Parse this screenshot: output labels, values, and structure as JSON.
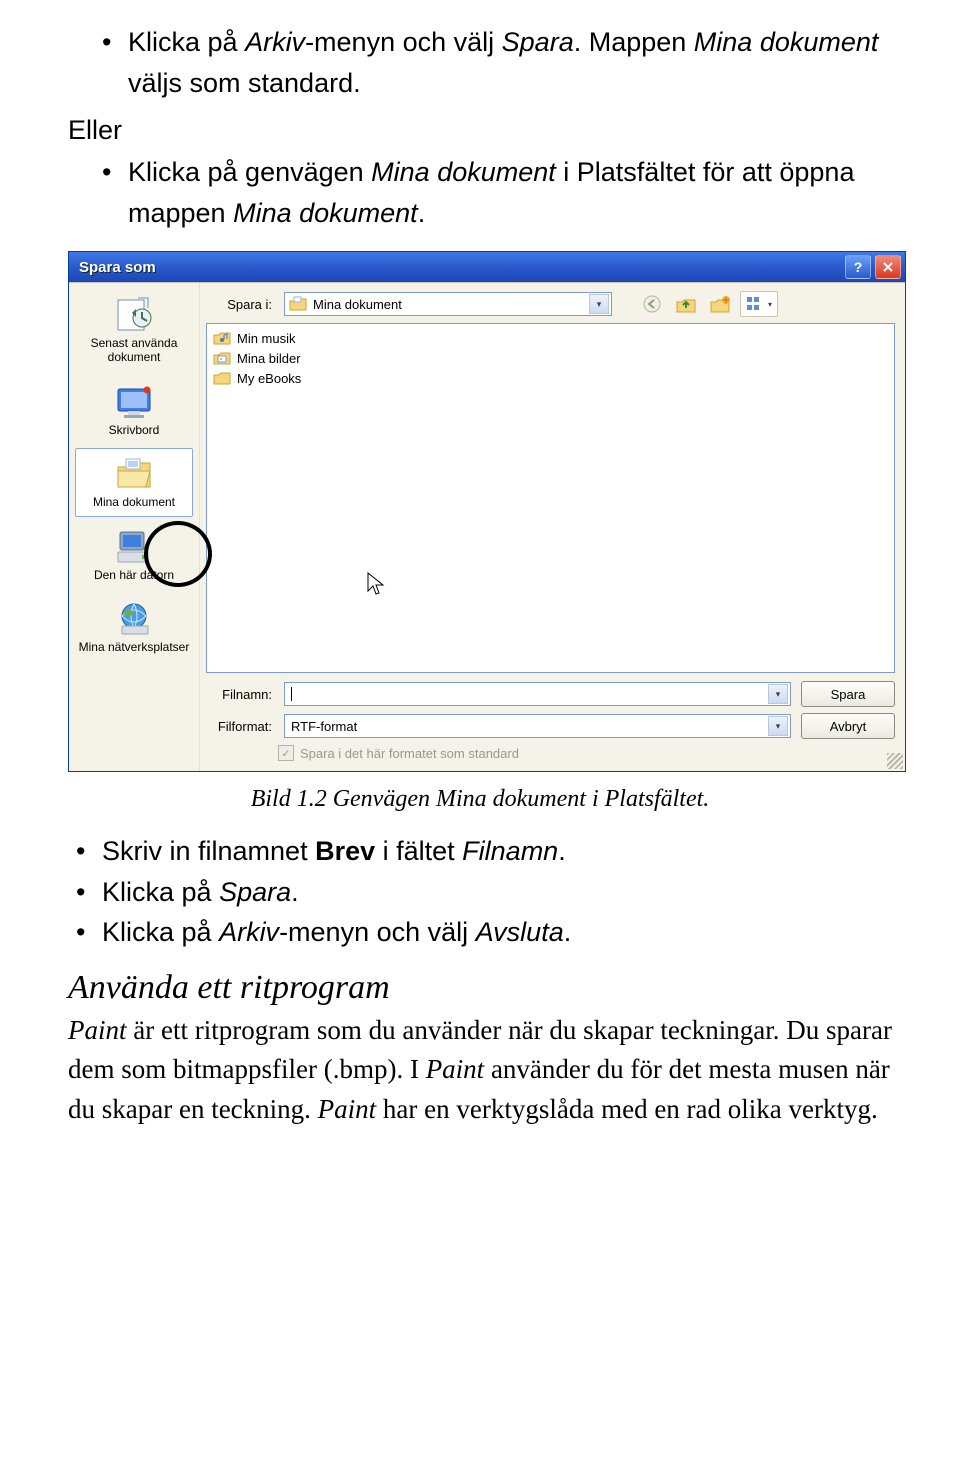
{
  "doc": {
    "bullet1_a": "Klicka på ",
    "bullet1_b": "Arkiv",
    "bullet1_c": "-menyn och välj ",
    "bullet1_d": "Spara",
    "bullet1_e": ". Mappen ",
    "bullet1_f": "Mina dokument",
    "bullet1_g": " väljs som standard.",
    "eller": "Eller",
    "bullet2_a": "Klicka på genvägen ",
    "bullet2_b": "Mina dokument",
    "bullet2_c": " i Platsfältet för att öppna mappen ",
    "bullet2_d": "Mina dokument",
    "bullet2_e": ".",
    "caption": "Bild 1.2 Genvägen Mina dokument i Platsfältet.",
    "bullet3_a": "Skriv in filnamnet ",
    "bullet3_b": "Brev",
    "bullet3_c": " i fältet ",
    "bullet3_d": "Filnamn",
    "bullet3_e": ".",
    "bullet4_a": "Klicka på ",
    "bullet4_b": "Spara",
    "bullet4_c": ".",
    "bullet5_a": "Klicka på ",
    "bullet5_b": "Arkiv",
    "bullet5_c": "-menyn och välj ",
    "bullet5_d": "Avsluta",
    "bullet5_e": ".",
    "heading": "Använda ett ritprogram",
    "para_a": "Paint",
    "para_b": " är ett ritprogram som du använder när du skapar teckningar. Du sparar dem som bitmappsfiler (.bmp). I ",
    "para_c": "Paint",
    "para_d": " använder du för det mesta musen när du skapar en teckning. ",
    "para_e": "Paint",
    "para_f": " har en verktygslåda med en rad olika verktyg."
  },
  "dialog": {
    "title": "Spara som",
    "help": "?",
    "close": "×",
    "savein_label": "Spara i:",
    "savein_value": "Mina dokument",
    "places": [
      "Senast använda dokument",
      "Skrivbord",
      "Mina dokument",
      "Den här datorn",
      "Mina nätverksplatser"
    ],
    "files": [
      "Min musik",
      "Mina bilder",
      "My eBooks"
    ],
    "filename_label": "Filnamn:",
    "filename_value": "",
    "fileformat_label": "Filformat:",
    "fileformat_value": "RTF-format",
    "save_btn": "Spara",
    "cancel_btn": "Avbryt",
    "checkbox_label": "Spara i det här formatet som standard"
  }
}
